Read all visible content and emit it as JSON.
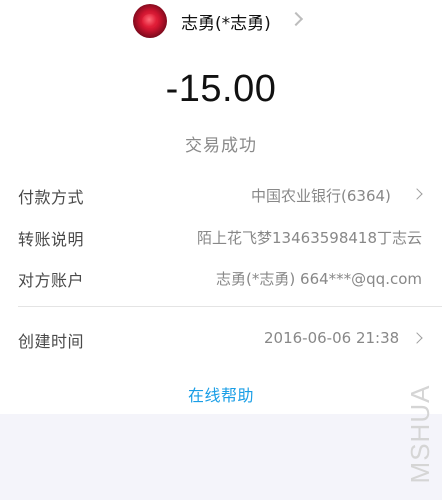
{
  "header": {
    "avatar_icon": "rose-avatar",
    "name": "志勇(*志勇)"
  },
  "amount": "-15.00",
  "status": "交易成功",
  "details": {
    "payment_method": {
      "label": "付款方式",
      "value": "中国农业银行(6364)"
    },
    "remark": {
      "label": "转账说明",
      "value": "陌上花飞梦13463598418丁志云"
    },
    "counterparty": {
      "label": "对方账户",
      "value": "志勇(*志勇) 664***@qq.com"
    },
    "created_time": {
      "label": "创建时间",
      "value": "2016-06-06 21:38"
    }
  },
  "help_link": "在线帮助",
  "watermark": "MSHUA",
  "colors": {
    "link": "#1a9ee6",
    "bottom_background": "#f4f4fa"
  }
}
